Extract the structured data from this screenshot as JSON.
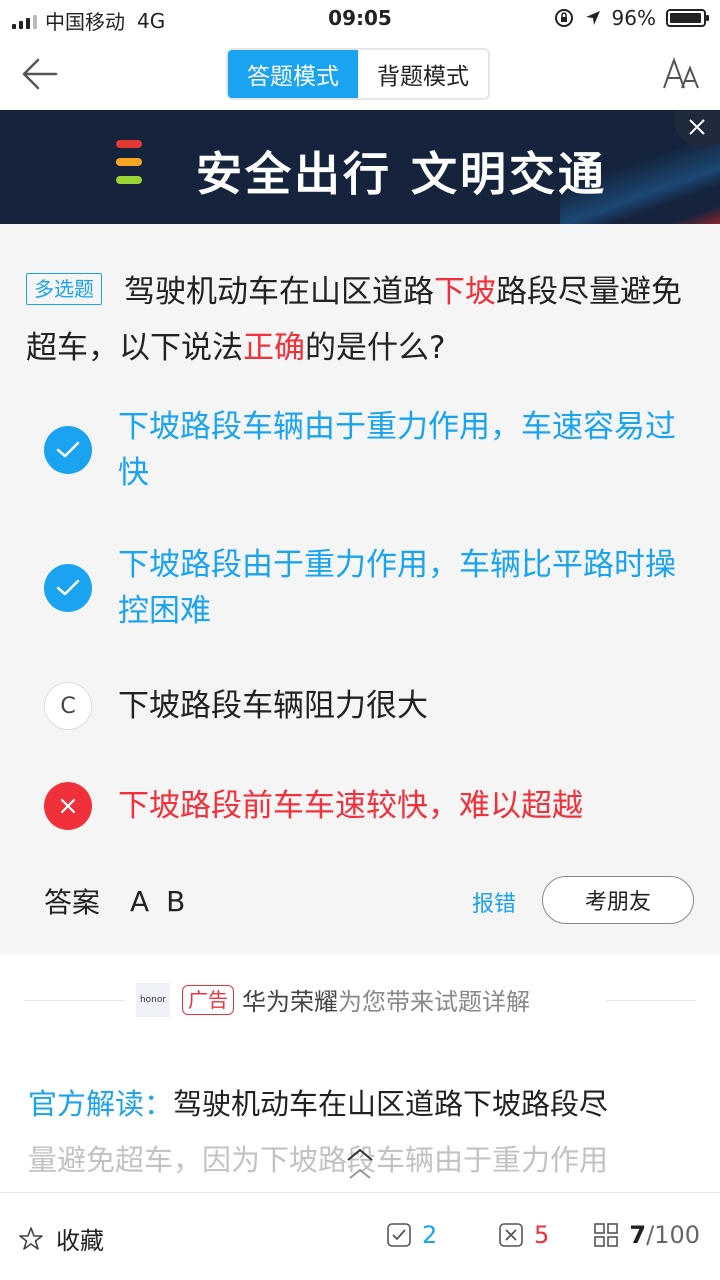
{
  "status_bar": {
    "carrier": "中国移动",
    "network": "4G",
    "time": "09:05",
    "battery": "96%",
    "battery_level": 0.96
  },
  "header": {
    "modes": [
      "答题模式",
      "背题模式"
    ],
    "active_mode": "答题模式",
    "back_icon": "back-arrow-icon",
    "font_icon": "font-size-icon"
  },
  "banner": {
    "text": "安全出行 文明交通",
    "close_icon": "close-icon"
  },
  "question": {
    "type_tag": "多选题",
    "text_part1": "驾驶机动车在山区道路",
    "text_hl1": "下坡",
    "text_part2": "路段尽量避免超车，以下说法",
    "text_hl2": "正确",
    "text_part3": "的是什么?"
  },
  "options": [
    {
      "state": "correct",
      "marker": "",
      "text": "下坡路段车辆由于重力作用，车速容易过快"
    },
    {
      "state": "correct",
      "marker": "",
      "text": "下坡路段由于重力作用，车辆比平路时操控困难"
    },
    {
      "state": "normal",
      "marker": "C",
      "text": "下坡路段车辆阻力很大"
    },
    {
      "state": "wrong",
      "marker": "",
      "text": "下坡路段前车车速较快，难以超越"
    }
  ],
  "answer": {
    "label": "答案",
    "value": "A B",
    "report_label": "报错",
    "ask_friend_label": "考朋友"
  },
  "sponsor": {
    "logo_text": "honor",
    "ad_tag": "广告",
    "sponsor_name": "华为荣耀",
    "sponsor_rest": "为您带来试题详解"
  },
  "explanation": {
    "label": "官方解读：",
    "line1": "驾驶机动车在山区道路下坡路段尽",
    "line2": "量避免超车，因为下坡路段车辆由于重力作用"
  },
  "bottom_bar": {
    "favorite_label": "收藏",
    "correct_count": "2",
    "wrong_count": "5",
    "current": "7",
    "total": "/100"
  },
  "colors": {
    "accent": "#1aa3f0",
    "error": "#f0313c",
    "banner_bg": "#15233c"
  }
}
